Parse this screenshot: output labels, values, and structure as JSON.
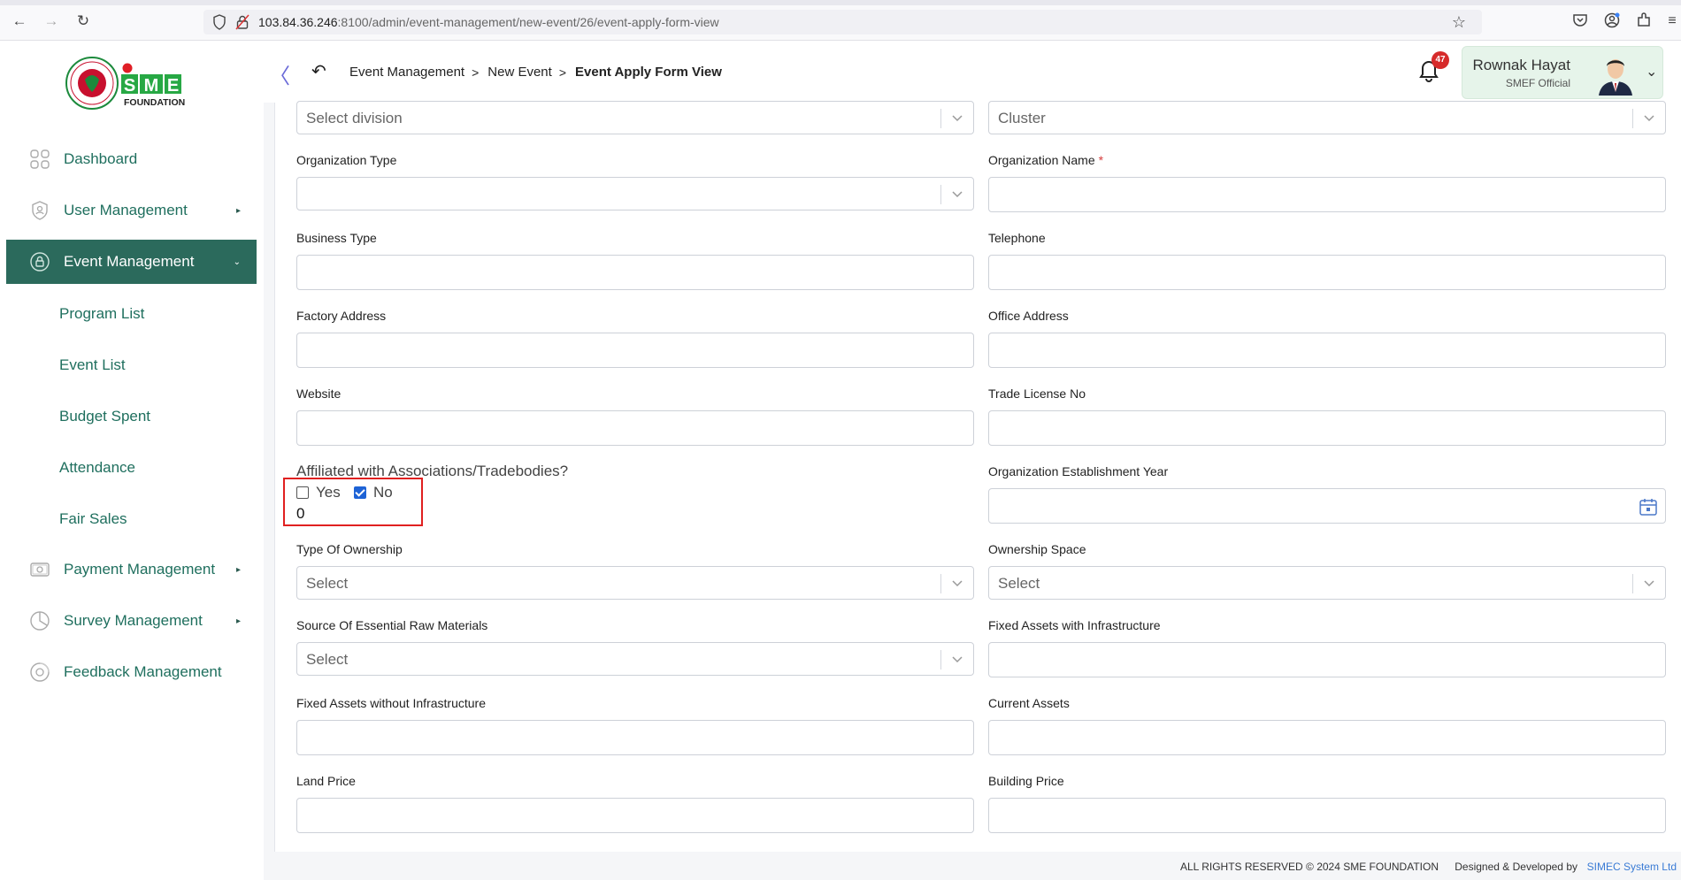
{
  "browser": {
    "url_host": "103.84.36.246",
    "url_rest": ":8100/admin/event-management/new-event/26/event-apply-form-view"
  },
  "header": {
    "breadcrumbs": [
      "Event Management",
      "New Event",
      "Event Apply Form View"
    ],
    "notification_count": "47",
    "user_name": "Rownak Hayat",
    "user_role": "SMEF Official",
    "logo_text": "SME",
    "logo_sub": "FOUNDATION"
  },
  "sidebar": {
    "items": [
      {
        "label": "Dashboard",
        "icon": "dashboard-icon"
      },
      {
        "label": "User Management",
        "icon": "shield-user-icon"
      },
      {
        "label": "Event Management",
        "icon": "event-icon"
      },
      {
        "label": "Payment Management",
        "icon": "payment-icon"
      },
      {
        "label": "Survey Management",
        "icon": "pie-chart-icon"
      },
      {
        "label": "Feedback Management",
        "icon": "feedback-icon"
      }
    ],
    "sub_items": [
      "Program List",
      "Event List",
      "Budget Spent",
      "Attendance",
      "Fair Sales"
    ]
  },
  "form": {
    "division_placeholder": "Select division",
    "cluster_placeholder": "Cluster",
    "organization_type_label": "Organization Type",
    "organization_name_label": "Organization Name",
    "business_type_label": "Business Type",
    "telephone_label": "Telephone",
    "factory_address_label": "Factory Address",
    "office_address_label": "Office Address",
    "website_label": "Website",
    "trade_license_label": "Trade License No",
    "affiliated_label": "Affiliated with Associations/Tradebodies?",
    "affiliated_yes": "Yes",
    "affiliated_no": "No",
    "affiliated_value": "0",
    "establishment_year_label": "Organization Establishment Year",
    "type_of_ownership_label": "Type Of Ownership",
    "ownership_space_label": "Ownership Space",
    "select_placeholder": "Select",
    "raw_materials_label": "Source Of Essential Raw Materials",
    "fixed_assets_with_label": "Fixed Assets with Infrastructure",
    "fixed_assets_without_label": "Fixed Assets without Infrastructure",
    "current_assets_label": "Current Assets",
    "land_price_label": "Land Price",
    "building_price_label": "Building Price"
  },
  "footer": {
    "rights": "ALL RIGHTS RESERVED © 2024 SME FOUNDATION",
    "designed": "Designed & Developed by",
    "developer": "SIMEC System Ltd"
  }
}
